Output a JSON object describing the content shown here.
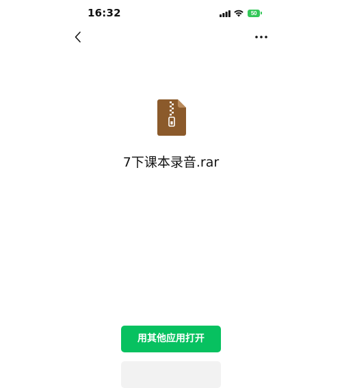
{
  "status_bar": {
    "time": "16:32",
    "battery_level": "50",
    "battery_color": "#34c759",
    "icons": [
      "signal-icon",
      "wifi-icon",
      "battery-icon"
    ]
  },
  "nav": {
    "back_icon": "chevron-left-icon",
    "more_icon": "ellipsis-icon"
  },
  "file": {
    "name": "7下课本录音.rar",
    "icon": "zip-archive-icon",
    "icon_color": "#8b5a2b"
  },
  "actions": {
    "open_with_label": "用其他应用打开",
    "accent_color": "#07c160"
  }
}
